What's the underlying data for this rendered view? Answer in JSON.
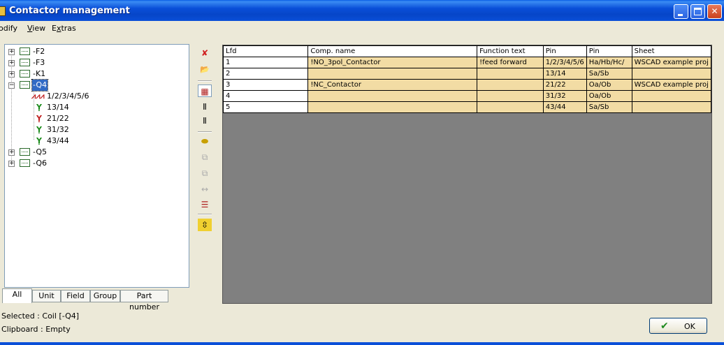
{
  "window": {
    "title": "Contactor management",
    "min_glyph": "",
    "max_glyph": "",
    "close_glyph": "✕"
  },
  "menu": [
    {
      "label_pre": "",
      "label_ul": "",
      "label_post": "odify"
    },
    {
      "label_pre": "",
      "label_ul": "V",
      "label_post": "iew"
    },
    {
      "label_pre": "E",
      "label_ul": "x",
      "label_post": "tras"
    }
  ],
  "tree": {
    "nodes": [
      {
        "label": "-F2",
        "expander": "+"
      },
      {
        "label": "-F3",
        "expander": "+"
      },
      {
        "label": "-K1",
        "expander": "+"
      },
      {
        "label": "-Q4",
        "expander": "−",
        "selected": true
      },
      {
        "label": "1/2/3/4/5/6",
        "icon": "coil"
      },
      {
        "label": "13/14",
        "icon": "no-contact"
      },
      {
        "label": "21/22",
        "icon": "nc-contact"
      },
      {
        "label": "31/32",
        "icon": "no-contact"
      },
      {
        "label": "43/44",
        "icon": "no-contact"
      },
      {
        "label": "-Q5",
        "expander": "+"
      },
      {
        "label": "-Q6",
        "expander": "+"
      }
    ]
  },
  "tabs": [
    "All",
    "Unit",
    "Field",
    "Group",
    "Part number"
  ],
  "toolbar": [
    {
      "name": "delete-icon",
      "glyph": "✘",
      "color": "#d02020"
    },
    {
      "name": "open-folder-icon",
      "glyph": "📂",
      "color": "#c08000"
    },
    {
      "name": "table-view-icon",
      "glyph": "▦",
      "color": "#b02020"
    },
    {
      "name": "contact-icon",
      "glyph": "Ⅱ",
      "color": "#000000"
    },
    {
      "name": "contact-multi-icon",
      "glyph": "Ⅱ",
      "color": "#000000"
    },
    {
      "name": "eraser-icon",
      "glyph": "⬬",
      "color": "#c8a000"
    },
    {
      "name": "copy-icon",
      "glyph": "⧉",
      "color": "#aaaaaa"
    },
    {
      "name": "paste-icon",
      "glyph": "⧉",
      "color": "#aaaaaa"
    },
    {
      "name": "swap-pins-icon",
      "glyph": "↔",
      "color": "#aaaaaa"
    },
    {
      "name": "settings-sliders-icon",
      "glyph": "☰",
      "color": "#b02020"
    },
    {
      "name": "sort-icon",
      "glyph": "⇳",
      "color": "#000000"
    }
  ],
  "grid": {
    "headers": [
      "Lfd",
      "Comp. name",
      "Function text",
      "Pin",
      "Pin",
      "Sheet"
    ],
    "rows": [
      [
        "1",
        "!NO_3pol_Contactor",
        "!feed forward",
        "1/2/3/4/5/6",
        "Ha/Hb/Hc/",
        "WSCAD example proj"
      ],
      [
        "2",
        "",
        "",
        "13/14",
        "Sa/Sb",
        ""
      ],
      [
        "3",
        "!NC_Contactor",
        "",
        "21/22",
        "Oa/Ob",
        "WSCAD example proj"
      ],
      [
        "4",
        "",
        "",
        "31/32",
        "Oa/Ob",
        ""
      ],
      [
        "5",
        "",
        "",
        "43/44",
        "Sa/Sb",
        ""
      ]
    ]
  },
  "status": {
    "selected": "Selected : Coil [-Q4]",
    "clipboard": "Clipboard : Empty"
  },
  "ok_button": {
    "label": "OK",
    "glyph": "✔"
  },
  "colors": {
    "titlebar": "#0a4fd8",
    "grid_cell": "#f2dca4",
    "grid_background": "#808080",
    "selection": "#316ac5"
  }
}
